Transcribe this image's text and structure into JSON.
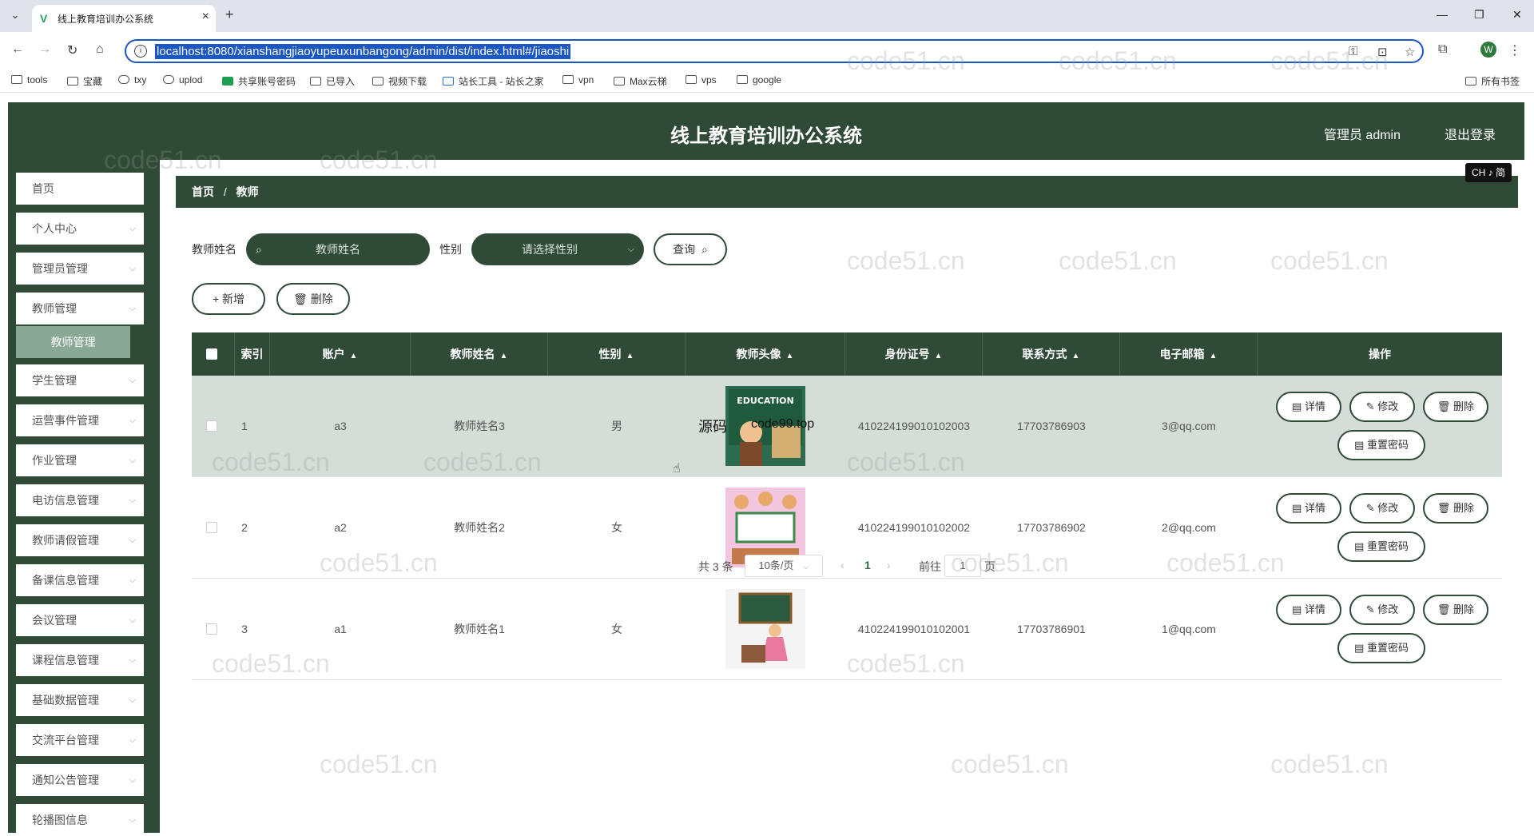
{
  "browser": {
    "tab_title": "线上教育培训办公系统",
    "url": "localhost:8080/xianshangjiaoyupeuxunbangong/admin/dist/index.html#/jiaoshi",
    "profile_initial": "W",
    "bookmarks": [
      "tools",
      "宝藏",
      "txy",
      "uplod",
      "共享账号密码",
      "已导入",
      "视频下载",
      "站长工具 - 站长之家",
      "vpn",
      "Max云梯",
      "vps",
      "google"
    ],
    "all_bookmarks": "所有书签"
  },
  "app": {
    "title": "线上教育培训办公系统",
    "admin_label": "管理员 admin",
    "logout_label": "退出登录",
    "lang_badge": "CH ♪ 简"
  },
  "sidebar": {
    "items": [
      "首页",
      "个人中心",
      "管理员管理",
      "教师管理",
      "学生管理",
      "运营事件管理",
      "作业管理",
      "电访信息管理",
      "教师请假管理",
      "备课信息管理",
      "会议管理",
      "课程信息管理",
      "基础数据管理",
      "交流平台管理",
      "通知公告管理",
      "轮播图信息"
    ],
    "active_sub": "教师管理"
  },
  "breadcrumb": {
    "home": "首页",
    "sep": "/",
    "current": "教师"
  },
  "filters": {
    "name_label": "教师姓名",
    "name_placeholder": "教师姓名",
    "gender_label": "性别",
    "gender_placeholder": "请选择性别",
    "query_button": "查询"
  },
  "toolbar": {
    "add_button": "+ 新增",
    "delete_button": "删除"
  },
  "table": {
    "columns": [
      "索引",
      "账户",
      "教师姓名",
      "性别",
      "教师头像",
      "身份证号",
      "联系方式",
      "电子邮箱",
      "操作"
    ],
    "rows": [
      {
        "index": "1",
        "account": "a3",
        "name": "教师姓名3",
        "gender": "男",
        "id_card": "410224199010102003",
        "phone": "17703786903",
        "email": "3@qq.com"
      },
      {
        "index": "2",
        "account": "a2",
        "name": "教师姓名2",
        "gender": "女",
        "id_card": "410224199010102002",
        "phone": "17703786902",
        "email": "2@qq.com"
      },
      {
        "index": "3",
        "account": "a1",
        "name": "教师姓名1",
        "gender": "女",
        "id_card": "410224199010102001",
        "phone": "17703786901",
        "email": "1@qq.com"
      }
    ],
    "actions": {
      "detail": "详情",
      "edit": "修改",
      "delete": "删除",
      "reset": "重置密码"
    },
    "image_caption": "源码"
  },
  "pagination": {
    "total": "共 3 条",
    "page_size": "10条/页",
    "current_page": "1",
    "goto_label": "前往",
    "goto_value": "1",
    "page_suffix": "页"
  },
  "watermark": "code51.cn",
  "overlay_text": "code99.top"
}
